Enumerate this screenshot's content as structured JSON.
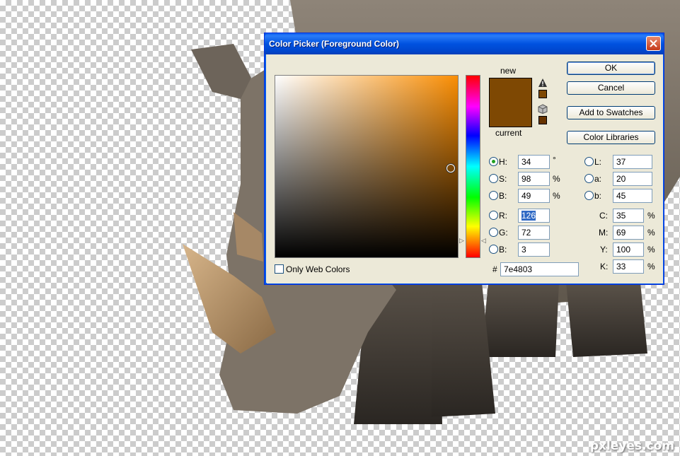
{
  "dialog": {
    "title": "Color Picker (Foreground Color)",
    "ok_label": "OK",
    "cancel_label": "Cancel",
    "add_swatches_label": "Add to Swatches",
    "color_libraries_label": "Color Libraries",
    "new_label": "new",
    "current_label": "current",
    "only_web_colors_label": "Only Web Colors",
    "only_web_colors_checked": false,
    "new_color": "#7e4803",
    "current_color": "#7e4803",
    "gamut_warning_color": "#7e4803",
    "web_safe_color": "#663300",
    "hue_slider_level": 0.094
  },
  "fields": {
    "H": {
      "label": "H:",
      "value": "34",
      "unit": "°",
      "selected": true
    },
    "S": {
      "label": "S:",
      "value": "98",
      "unit": "%"
    },
    "B": {
      "label": "B:",
      "value": "49",
      "unit": "%"
    },
    "R": {
      "label": "R:",
      "value": "126"
    },
    "G": {
      "label": "G:",
      "value": "72"
    },
    "Bl": {
      "label": "B:",
      "value": "3"
    },
    "L": {
      "label": "L:",
      "value": "37"
    },
    "a": {
      "label": "a:",
      "value": "20"
    },
    "b": {
      "label": "b:",
      "value": "45"
    },
    "C": {
      "label": "C:",
      "value": "35",
      "unit": "%"
    },
    "M": {
      "label": "M:",
      "value": "69",
      "unit": "%"
    },
    "Y": {
      "label": "Y:",
      "value": "100",
      "unit": "%"
    },
    "K": {
      "label": "K:",
      "value": "33",
      "unit": "%"
    },
    "hex": {
      "label": "#",
      "value": "7e4803"
    }
  },
  "watermark": "pxleyes.com",
  "icons": {
    "close": "close-icon",
    "warning": "gamut-warning-icon",
    "cube": "web-safe-cube-icon"
  }
}
